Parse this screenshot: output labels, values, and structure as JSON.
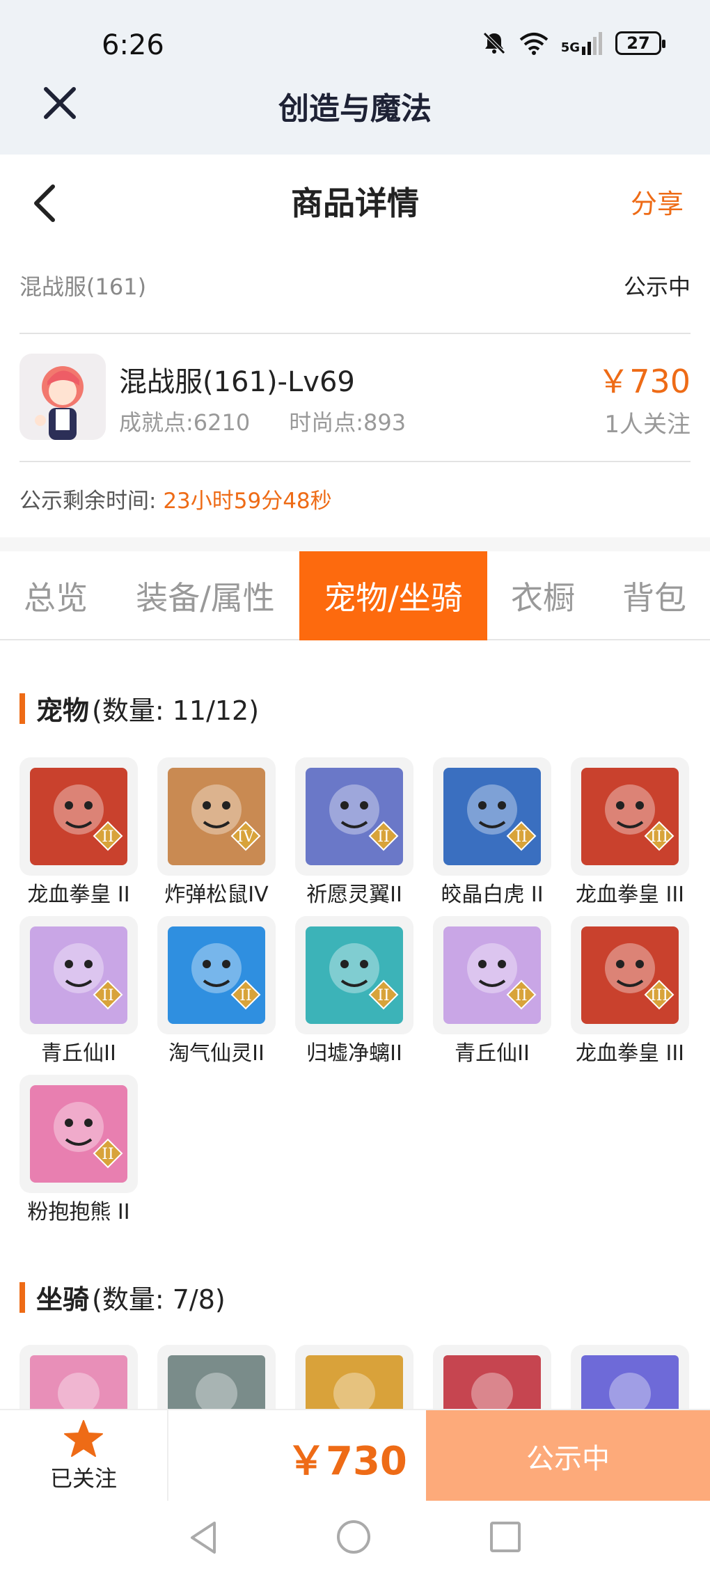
{
  "status_bar": {
    "time": "6:26",
    "network": "5G",
    "battery": "27"
  },
  "app_bar": {
    "title": "创造与魔法"
  },
  "header": {
    "title": "商品详情",
    "share": "分享"
  },
  "server": {
    "name": "混战服(161)",
    "status": "公示中"
  },
  "item": {
    "name": "混战服(161)-Lv69",
    "achievement": "成就点:6210",
    "fashion": "时尚点:893",
    "price": "￥730",
    "followers": "1人关注"
  },
  "countdown": {
    "label": "公示剩余时间:",
    "value": "23小时59分48秒"
  },
  "tabs": [
    {
      "label": "总览",
      "active": false
    },
    {
      "label": "装备/属性",
      "active": false
    },
    {
      "label": "宠物/坐骑",
      "active": true
    },
    {
      "label": "衣橱",
      "active": false
    },
    {
      "label": "背包",
      "active": false
    }
  ],
  "pets_section": {
    "title": "宠物",
    "count": "(数量: 11/12)"
  },
  "pets": [
    {
      "name": "龙血拳皇 II",
      "tier": "II",
      "color": "#c9412d"
    },
    {
      "name": "炸弹松鼠IV",
      "tier": "IV",
      "color": "#c98a52"
    },
    {
      "name": "祈愿灵翼II",
      "tier": "II",
      "color": "#6a78c8"
    },
    {
      "name": "皎晶白虎 II",
      "tier": "II",
      "color": "#3a6fc0"
    },
    {
      "name": "龙血拳皇 III",
      "tier": "III",
      "color": "#c9412d"
    },
    {
      "name": "青丘仙II",
      "tier": "II",
      "color": "#c9a6e6"
    },
    {
      "name": "淘气仙灵II",
      "tier": "II",
      "color": "#2f8fe0"
    },
    {
      "name": "归墟净螭II",
      "tier": "II",
      "color": "#3cb3b8"
    },
    {
      "name": "青丘仙II",
      "tier": "II",
      "color": "#c9a6e6"
    },
    {
      "name": "龙血拳皇 III",
      "tier": "III",
      "color": "#c9412d"
    },
    {
      "name": "粉抱抱熊 II",
      "tier": "II",
      "color": "#e87fb0"
    }
  ],
  "mounts_section": {
    "title": "坐骑",
    "count": "(数量: 7/8)"
  },
  "mounts": [
    {
      "color": "#e88fb8"
    },
    {
      "color": "#7a8c8a"
    },
    {
      "color": "#d9a23a"
    },
    {
      "color": "#c64550"
    },
    {
      "color": "#6e6ad8"
    }
  ],
  "bottom_bar": {
    "follow_label": "已关注",
    "price": "￥730",
    "action": "公示中"
  },
  "colors": {
    "accent": "#ee6b16",
    "tab_active": "#fd6a0e",
    "action_btn": "#fdaa7a"
  }
}
